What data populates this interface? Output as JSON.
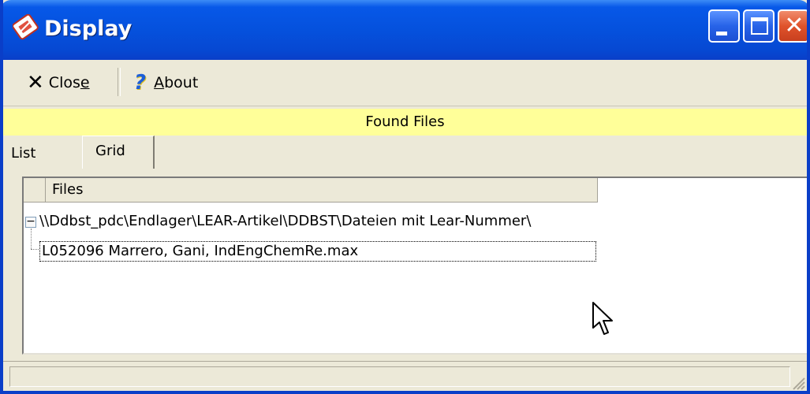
{
  "window": {
    "title": "Display",
    "icon": "display-app-icon",
    "controls": {
      "minimize": "minimize-icon",
      "maximize": "maximize-icon",
      "close": "close-icon",
      "close_glyph": "✕"
    }
  },
  "toolbar": {
    "close_pre": "Clos",
    "close_u": "e",
    "close_icon": "x-icon",
    "about_u": "A",
    "about_post": "bout",
    "about_icon": "question-icon"
  },
  "found_bar": {
    "label": "Found Files",
    "color": "#FFFF99"
  },
  "tabs": [
    {
      "label": "List",
      "active": false
    },
    {
      "label": "Grid",
      "active": true
    }
  ],
  "grid": {
    "column_header": "Files",
    "tree": {
      "toggle_glyph": "−",
      "path": "\\\\Ddbst_pdc\\Endlager\\LEAR-Artikel\\DDBST\\Dateien mit Lear-Nummer\\",
      "children": [
        "L052096 Marrero, Gani, IndEngChemRe.max"
      ]
    }
  },
  "colors": {
    "titlebar": "#0551dd",
    "window_bg": "#ECE9D8",
    "found_bar": "#FFFF99"
  }
}
